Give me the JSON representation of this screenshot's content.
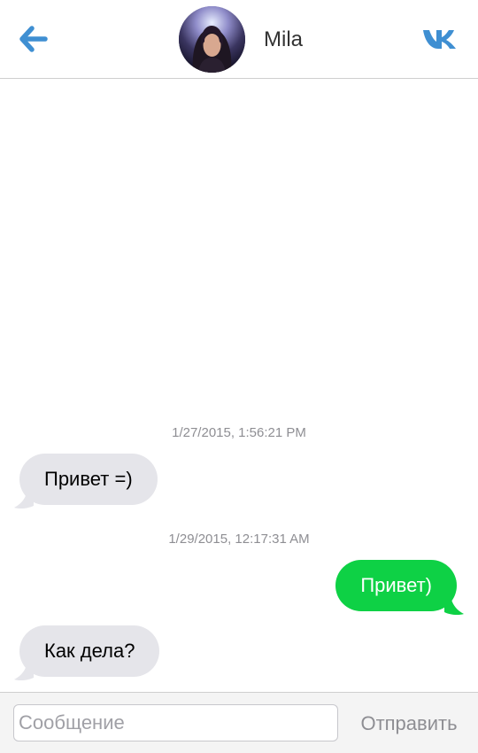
{
  "colors": {
    "accent": "#3f8fd2",
    "incoming_bubble": "#e5e5ea",
    "outgoing_bubble": "#0ed145",
    "timestamp": "#8e8e93"
  },
  "header": {
    "back_icon": "back-arrow-icon",
    "contact_name": "Mila",
    "service_icon": "vk-logo-icon"
  },
  "messages": [
    {
      "timestamp": "1/27/2015, 1:56:21 PM"
    },
    {
      "direction": "incoming",
      "text": "Привет =)"
    },
    {
      "timestamp": "1/29/2015, 12:17:31 AM"
    },
    {
      "direction": "outgoing",
      "text": "Привет)"
    },
    {
      "direction": "incoming",
      "text": "Как дела?"
    }
  ],
  "composer": {
    "placeholder": "Сообщение",
    "value": "",
    "send_label": "Отправить"
  }
}
